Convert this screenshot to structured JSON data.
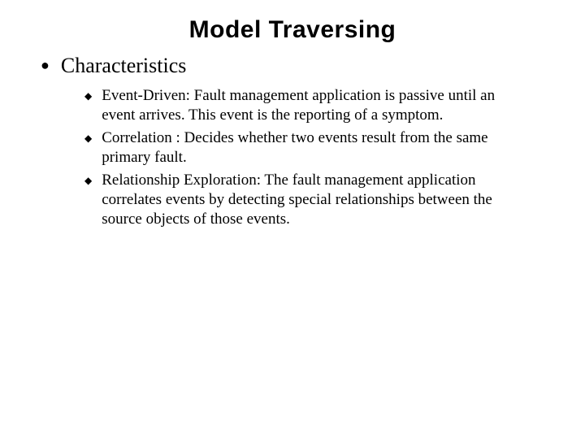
{
  "title": "Model Traversing",
  "section": {
    "heading": "Characteristics",
    "items": [
      "Event-Driven: Fault management application is passive until an event arrives.  This event is the reporting of a symptom.",
      "Correlation : Decides whether two events result from the same primary fault.",
      "Relationship Exploration: The fault management application correlates events by detecting special relationships between the source objects of those events."
    ]
  }
}
